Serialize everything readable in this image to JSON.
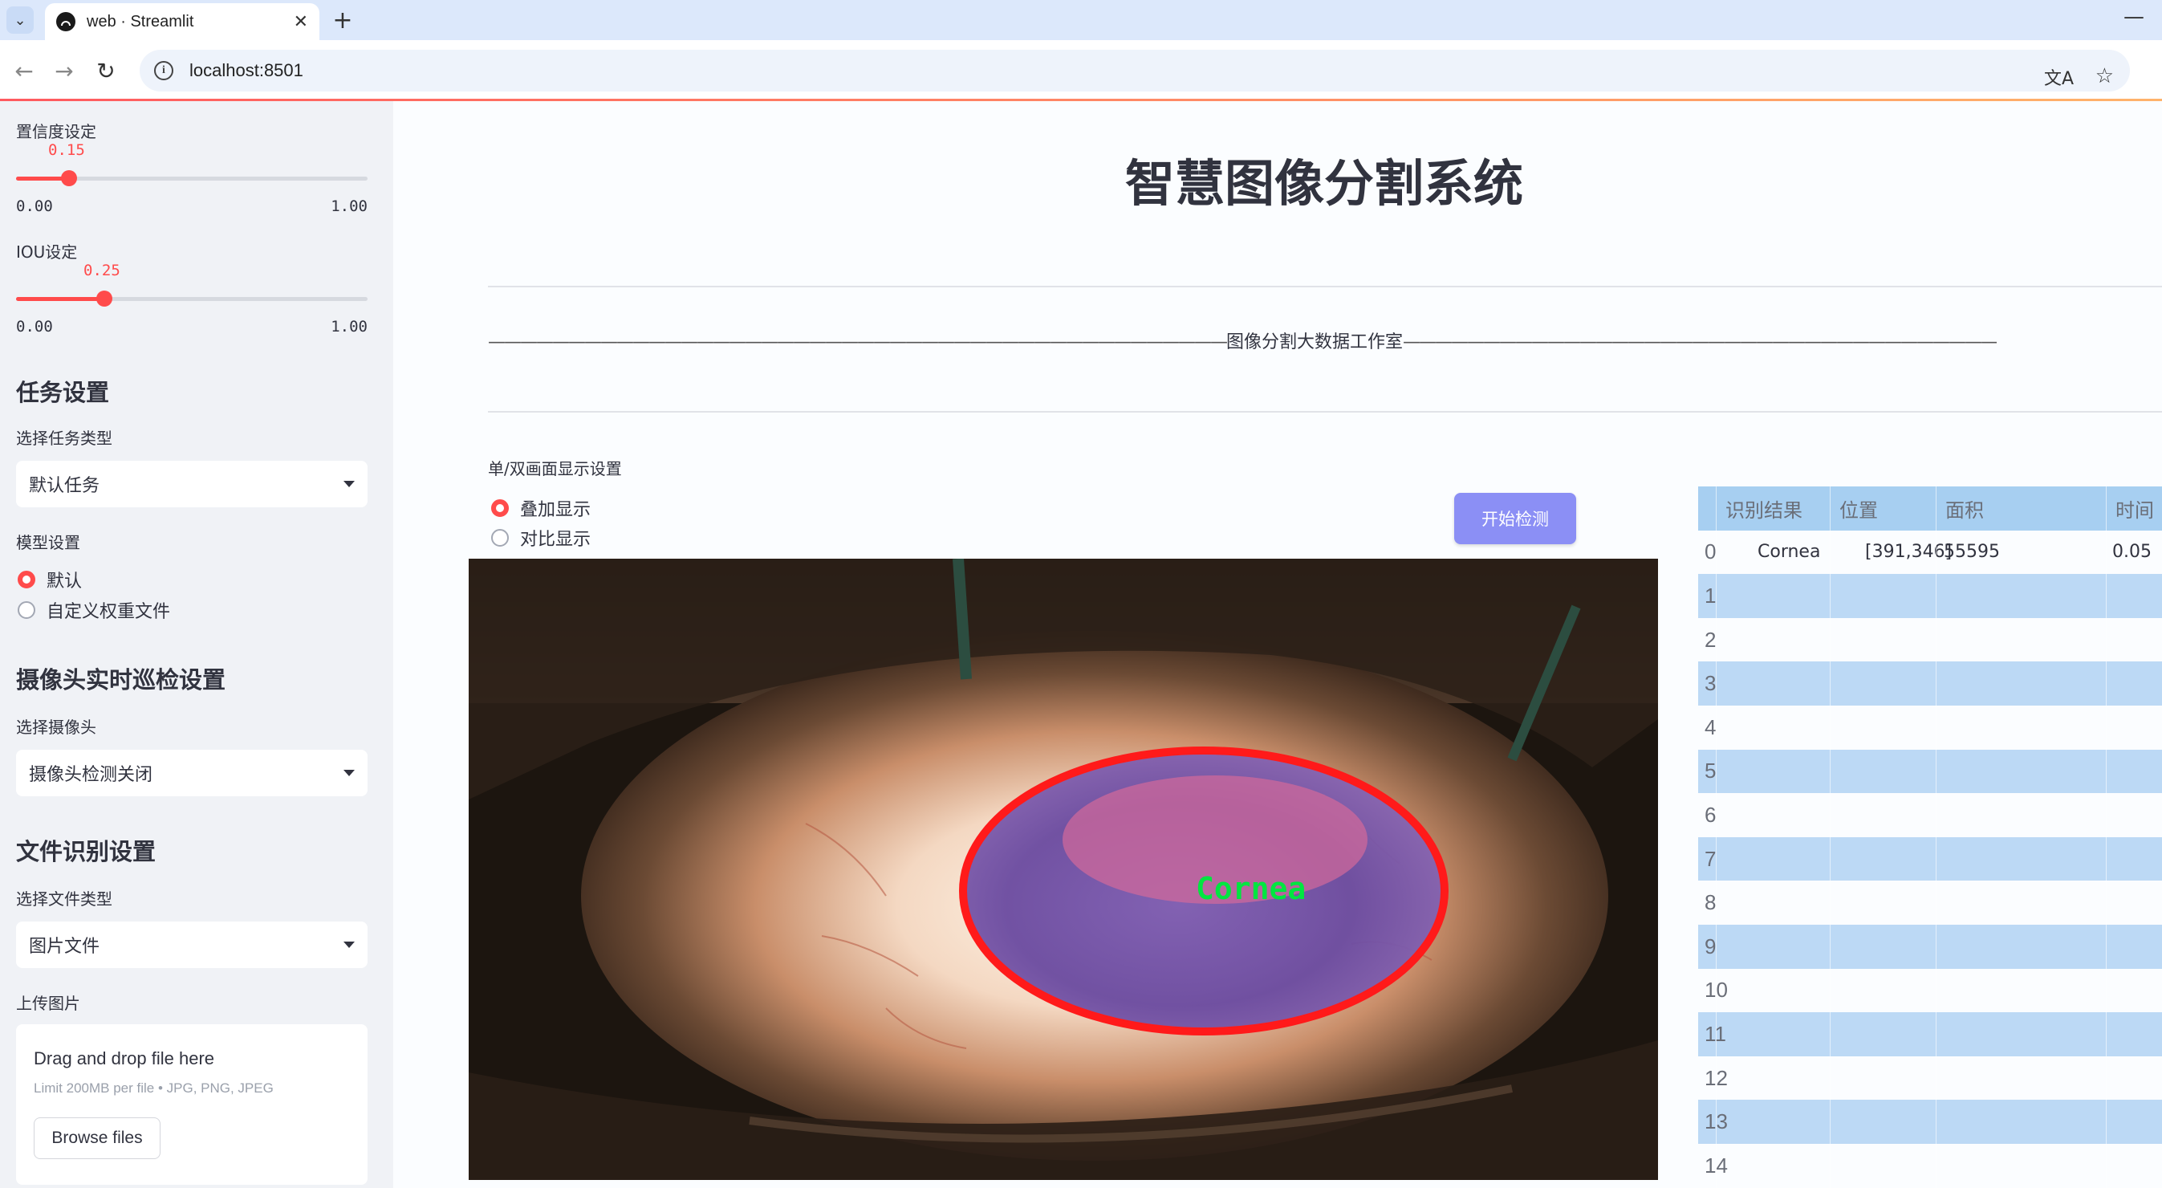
{
  "browser": {
    "tab_title": "web · Streamlit",
    "url": "localhost:8501"
  },
  "sidebar": {
    "confidence_label": "置信度设定",
    "confidence_value": "0.15",
    "confidence_min": "0.00",
    "confidence_max": "1.00",
    "confidence_fraction": 0.15,
    "iou_label": "IOU设定",
    "iou_value": "0.25",
    "iou_min": "0.00",
    "iou_max": "1.00",
    "iou_fraction": 0.25,
    "task_heading": "任务设置",
    "task_type_label": "选择任务类型",
    "task_type_value": "默认任务",
    "model_label": "模型设置",
    "model_options": [
      "默认",
      "自定义权重文件"
    ],
    "model_selected": "默认",
    "camera_heading": "摄像头实时巡检设置",
    "camera_label": "选择摄像头",
    "camera_value": "摄像头检测关闭",
    "file_heading": "文件识别设置",
    "file_type_label": "选择文件类型",
    "file_type_value": "图片文件",
    "upload_label": "上传图片",
    "upload_main": "Drag and drop file here",
    "upload_sub": "Limit 200MB per file • JPG, PNG, JPEG",
    "browse_label": "Browse files"
  },
  "main": {
    "title": "智慧图像分割系统",
    "studio_text": "图像分割大数据工作室",
    "display_mode_label": "单/双画面显示设置",
    "display_options": [
      "叠加显示",
      "对比显示"
    ],
    "display_selected": "叠加显示",
    "start_button": "开始检测",
    "detection_label": "Cornea"
  },
  "results_table": {
    "columns": [
      "",
      "识别结果",
      "位置",
      "面积",
      "时间"
    ],
    "rows": [
      {
        "idx": "0",
        "result": "Cornea",
        "position": "[391,346]",
        "area": "55595",
        "time": "0.05"
      },
      {
        "idx": "1",
        "result": "",
        "position": "",
        "area": "",
        "time": ""
      },
      {
        "idx": "2",
        "result": "",
        "position": "",
        "area": "",
        "time": ""
      },
      {
        "idx": "3",
        "result": "",
        "position": "",
        "area": "",
        "time": ""
      },
      {
        "idx": "4",
        "result": "",
        "position": "",
        "area": "",
        "time": ""
      },
      {
        "idx": "5",
        "result": "",
        "position": "",
        "area": "",
        "time": ""
      },
      {
        "idx": "6",
        "result": "",
        "position": "",
        "area": "",
        "time": ""
      },
      {
        "idx": "7",
        "result": "",
        "position": "",
        "area": "",
        "time": ""
      },
      {
        "idx": "8",
        "result": "",
        "position": "",
        "area": "",
        "time": ""
      },
      {
        "idx": "9",
        "result": "",
        "position": "",
        "area": "",
        "time": ""
      },
      {
        "idx": "10",
        "result": "",
        "position": "",
        "area": "",
        "time": ""
      },
      {
        "idx": "11",
        "result": "",
        "position": "",
        "area": "",
        "time": ""
      },
      {
        "idx": "12",
        "result": "",
        "position": "",
        "area": "",
        "time": ""
      },
      {
        "idx": "13",
        "result": "",
        "position": "",
        "area": "",
        "time": ""
      },
      {
        "idx": "14",
        "result": "",
        "position": "",
        "area": "",
        "time": ""
      }
    ]
  },
  "colors": {
    "accent": "#ff4b4b",
    "button": "#8b8ff5",
    "table_header": "#a7cff1",
    "table_alt": "#bcd9f5",
    "mask_outline": "#ff1a1a",
    "label_text": "#00e640"
  }
}
